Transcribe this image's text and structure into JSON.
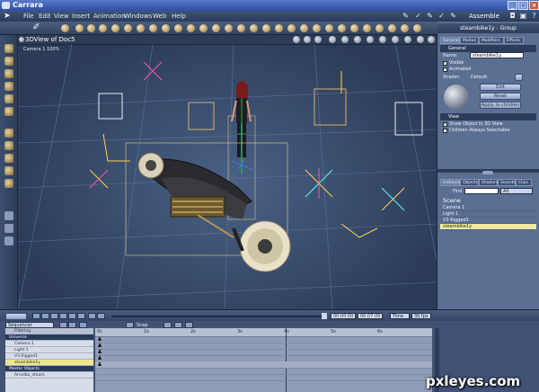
{
  "window": {
    "title": "Carrara"
  },
  "menu": [
    "File",
    "Edit",
    "View",
    "Insert",
    "Animation",
    "Windows",
    "Web",
    "Help"
  ],
  "room": "Assemble",
  "viewport": {
    "title": "3DView of Doc5",
    "camera": "Camera 1 100%"
  },
  "properties": {
    "header": "steambike1y - Group",
    "tabs": [
      "General",
      "Motion",
      "Modifiers",
      "Effects"
    ],
    "section_general": "General",
    "name_label": "Name:",
    "name_value": "steambike1y",
    "visible": "Visible",
    "animated": "Animated",
    "shader_label": "Shader:",
    "shader_value": "Default",
    "edit_button": "Edit",
    "reset_button": "Reset",
    "apply_button": "Apply to children",
    "section_view": "View",
    "show_object": "Show Object in 3D View",
    "children_selectable": "Children Always Selectable"
  },
  "browser": {
    "tabs": [
      "Instances",
      "Objects",
      "Shaders",
      "Sounds",
      "Clips"
    ],
    "find_label": "Find",
    "find_filter": "All",
    "scene_label": "Scene",
    "items": [
      "Camera 1",
      "Light 1",
      "V3 Rigged1",
      "steambike1y"
    ]
  },
  "timeline": {
    "current_time": "00:00:00",
    "end_time": "00:07:00",
    "units": "Time",
    "fps": "30 fps",
    "tween_label": "Snap",
    "ruler": [
      "0s",
      "1s",
      "2s",
      "3s",
      "4s",
      "5s",
      "6s"
    ]
  },
  "sequencer": {
    "mode": "Sequencer",
    "filtering": "Filtering",
    "tree": [
      {
        "label": "Universe",
        "type": "group"
      },
      {
        "label": "Camera 1",
        "type": "item"
      },
      {
        "label": "Light 1",
        "type": "item"
      },
      {
        "label": "V3 Rigged1",
        "type": "item"
      },
      {
        "label": "steambike1y",
        "type": "item",
        "selected": true
      },
      {
        "label": "Master Objects",
        "type": "group"
      },
      {
        "label": "Arnolbo_steam",
        "type": "item"
      }
    ]
  },
  "watermark": "pxleyes.com",
  "colors": {
    "accent": "#4d6ab8",
    "selection": "#f1e68e",
    "viewport_bg": "#3a4d6e"
  }
}
